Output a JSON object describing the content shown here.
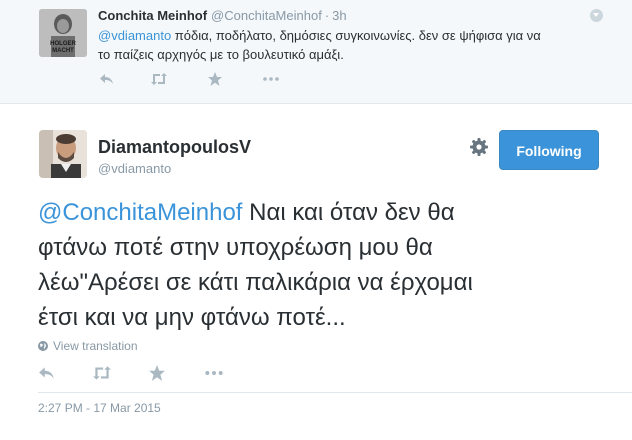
{
  "reply": {
    "name": "Conchita Meinhof",
    "handle": "@ConchitaMeinhof",
    "dot": "·",
    "time": "3h",
    "mention": "@vdiamanto",
    "text_line1": " πόδια, ποδήλατο, δημόσιες συγκοινωνίες. δεν σε ψήφισα για να",
    "text_line2": "το παίζεις αρχηγός με το βουλευτικό αμάξι.",
    "avatar_text_line1": "HOLGER",
    "avatar_text_line2": "MACHT"
  },
  "tweet": {
    "name": "DiamantopoulosV",
    "handle": "@vdiamanto",
    "follow_label": "Following",
    "mention": "@ConchitaMeinhof",
    "text_line1": " Ναι και όταν δεν θα",
    "text_line2": "φτάνω ποτέ στην υποχρέωση μου θα",
    "text_line3": "λέω\"Αρέσει σε κάτι παλικάρια να έρχομαι",
    "text_line4": "έτσι και να μην φτάνω ποτέ...",
    "view_translation": "View translation",
    "timestamp": "2:27 PM - 17 Mar 2015"
  },
  "icons": {
    "reply": "reply-icon",
    "retweet": "retweet-icon",
    "favorite": "star-icon",
    "more": "more-icon",
    "settings": "gear-icon",
    "translate": "globe-icon"
  },
  "colors": {
    "accent": "#3b94d9",
    "muted": "#8899a6",
    "icon": "#aab8c2",
    "reply_bg": "#f5f8fa"
  }
}
